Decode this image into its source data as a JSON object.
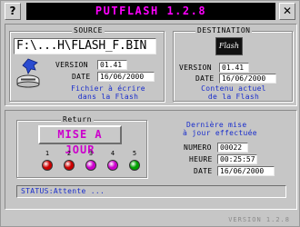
{
  "title_bar": {
    "title": "PUTFLASH 1.2.8",
    "help_label": "?",
    "close_label": "✕"
  },
  "source": {
    "legend": "SOURCE",
    "filename": "F:\\...H\\FLASH_F.BIN",
    "version_label": "VERSION",
    "version_value": "01.41",
    "date_label": "DATE",
    "date_value": "16/06/2000",
    "note_line1": "Fichier à écrire",
    "note_line2": "dans la Flash"
  },
  "destination": {
    "legend": "DESTINATION",
    "flash_icon_label": "Flash",
    "version_label": "VERSION",
    "version_value": "01.41",
    "date_label": "DATE",
    "date_value": "16/06/2000",
    "note_line1": "Contenu actuel",
    "note_line2": "de la Flash"
  },
  "return": {
    "legend": "Return",
    "button_label": "MISE A JOUR",
    "leds": [
      {
        "num": "1",
        "color": "#cc0000"
      },
      {
        "num": "2",
        "color": "#cc0000"
      },
      {
        "num": "3",
        "color": "#cc00cc"
      },
      {
        "num": "4",
        "color": "#cc00cc"
      },
      {
        "num": "5",
        "color": "#00a000"
      }
    ]
  },
  "last_update": {
    "heading_line1": "Dernière mise",
    "heading_line2": "à jour effectuée",
    "numero_label": "NUMERO",
    "numero_value": "00022",
    "heure_label": "HEURE",
    "heure_value": "00:25:57",
    "date_label": "DATE",
    "date_value": "16/06/2000"
  },
  "status": {
    "text": "STATUS:Attente ..."
  },
  "footer": {
    "version": "VERSION 1.2.8"
  }
}
